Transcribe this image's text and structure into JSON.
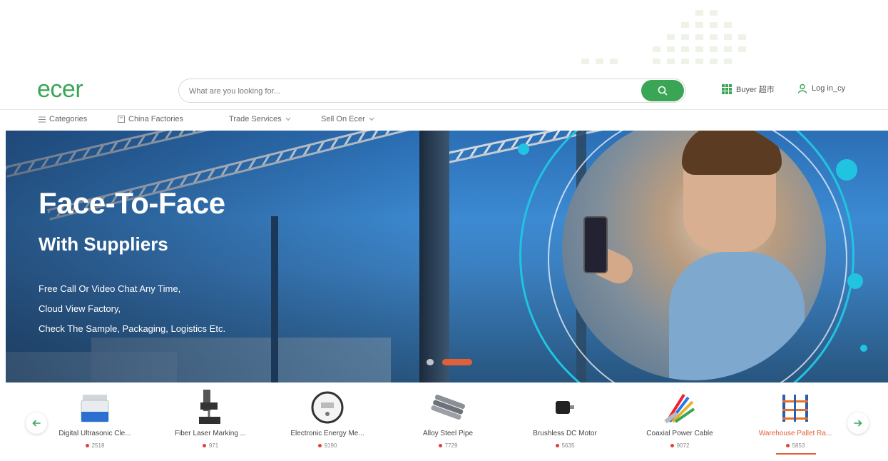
{
  "header": {
    "logo": "ecer",
    "search_placeholder": "What are you looking for...",
    "buyer_label": "Buyer 超市",
    "login_label": "Log in_cy"
  },
  "nav": {
    "items": [
      {
        "label": "Categories"
      },
      {
        "label": "China Factories"
      },
      {
        "label": "Trade Services"
      },
      {
        "label": "Sell On Ecer"
      }
    ]
  },
  "banner": {
    "title": "Face-To-Face",
    "subtitle": "With Suppliers",
    "lines": [
      "Free Call Or Video Chat Any Time,",
      "Cloud View Factory,",
      "Check The Sample, Packaging, Logistics Etc."
    ],
    "active_slide": 2,
    "slide_count": 2
  },
  "products": [
    {
      "name": "Digital Ultrasonic Cle...",
      "count": "2518",
      "icon": "ultrasonic-cleaner-icon"
    },
    {
      "name": "Fiber Laser Marking ...",
      "count": "971",
      "icon": "laser-marking-machine-icon"
    },
    {
      "name": "Electronic Energy Me...",
      "count": "9190",
      "icon": "energy-meter-icon"
    },
    {
      "name": "Alloy Steel Pipe",
      "count": "7729",
      "icon": "steel-pipe-icon"
    },
    {
      "name": "Brushless DC Motor",
      "count": "5635",
      "icon": "dc-motor-icon"
    },
    {
      "name": "Coaxial Power Cable",
      "count": "9072",
      "icon": "power-cable-icon"
    },
    {
      "name": "Warehouse Pallet Ra...",
      "count": "5853",
      "icon": "pallet-rack-icon"
    }
  ],
  "colors": {
    "brand": "#3aa655",
    "accent": "#e0603a",
    "cyan": "#21c4e0"
  }
}
